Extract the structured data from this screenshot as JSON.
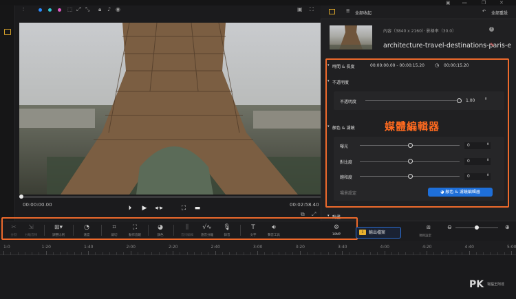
{
  "player": {
    "current_time": "00:00:00.00",
    "total_time": "00:02:58.40",
    "toolbar_icons": [
      "grid-icon",
      "color-dot-blue",
      "color-dot-cyan",
      "color-dot-pink",
      "crop-icon",
      "resize-icon",
      "resize-icon-2",
      "lock-icon",
      "audio-icon",
      "eye-icon"
    ]
  },
  "right_panel": {
    "tabs": [
      {
        "label": "",
        "icon": "panel-icon"
      },
      {
        "label": "全部收起",
        "icon": "list-icon"
      },
      {
        "label": "全部重設",
        "icon": "reset-icon"
      }
    ],
    "media": {
      "meta": "內容（3840 x 2160）· 影格率（30.0）",
      "name": "architecture-travel-destinations-paris-e"
    },
    "timing": {
      "label": "時間 & 長度",
      "range": "00:00:00.00 - 00:00:15.20",
      "duration": "00:00:15.20"
    },
    "opacity": {
      "section": "不透明度",
      "label": "不透明度",
      "value": "1.00",
      "level": 1.0
    },
    "color": {
      "section": "顏色 & 濾鏡",
      "rows": [
        {
          "label": "曝光",
          "value": "0"
        },
        {
          "label": "對比度",
          "value": "0"
        },
        {
          "label": "飽和度",
          "value": "0"
        }
      ],
      "preset_label": "場景設定",
      "button_label": "顏色 & 濾鏡編輯器"
    },
    "overlay_title": "媒體編輯器",
    "more_section": "動畫"
  },
  "tools": [
    {
      "label": "分割",
      "icon": "scissors-icon",
      "enabled": false
    },
    {
      "label": "分離音頻",
      "icon": "detach-icon",
      "enabled": false
    },
    {
      "label": "調整比例",
      "icon": "aspect-icon",
      "enabled": true
    },
    {
      "label": "速度",
      "icon": "speed-icon",
      "enabled": true
    },
    {
      "label": "裁切",
      "icon": "crop-icon",
      "enabled": true
    },
    {
      "label": "動作追蹤",
      "icon": "track-icon",
      "enabled": true
    },
    {
      "label": "調色",
      "icon": "palette-icon",
      "enabled": true
    },
    {
      "label": "音訊編輯",
      "icon": "audio-eq-icon",
      "enabled": false
    },
    {
      "label": "語音分離",
      "icon": "voice-split-icon",
      "enabled": true
    },
    {
      "label": "錄音",
      "icon": "mic-icon",
      "enabled": true
    },
    {
      "label": "文字",
      "icon": "text-icon",
      "enabled": true
    },
    {
      "label": "聲音工具",
      "icon": "speaker-icon",
      "enabled": true
    },
    {
      "label": "10MP",
      "icon": "settings-icon",
      "enabled": true
    }
  ],
  "export_label": "輸出檔案",
  "project_settings_label": "項目設定",
  "timeline": {
    "ticks": [
      "1:0",
      "1:20",
      "1:40",
      "2:00",
      "2:20",
      "2:40",
      "3:00",
      "3:20",
      "3:40",
      "4:00",
      "4:20",
      "4:40",
      "5:00"
    ]
  },
  "watermark": {
    "logo": "PK",
    "sub1": "電腦王阿達",
    "sub2": ""
  }
}
